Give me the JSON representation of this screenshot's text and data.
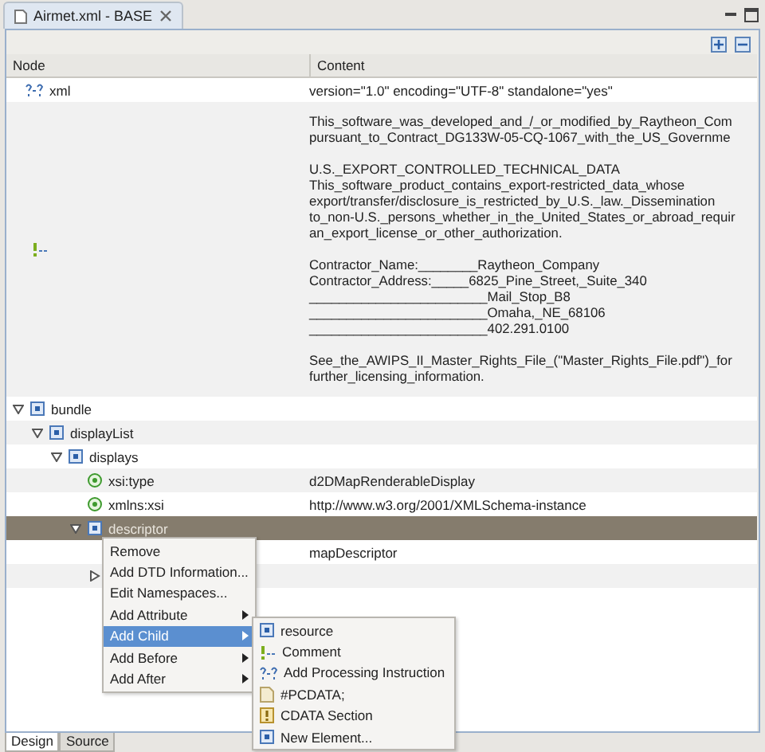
{
  "editor_tab": {
    "title": "Airmet.xml - BASE",
    "selected": true
  },
  "columns": [
    "Node",
    "Content"
  ],
  "declaration": {
    "name": "xml",
    "content": "version=\"1.0\" encoding=\"UTF-8\" standalone=\"yes\""
  },
  "comment": {
    "paragraphs": [
      [
        "This_software_was_developed_and_/_or_modified_by_Raytheon_Com",
        "pursuant_to_Contract_DG133W-05-CQ-1067_with_the_US_Governme"
      ],
      [
        "U.S._EXPORT_CONTROLLED_TECHNICAL_DATA",
        "This_software_product_contains_export-restricted_data_whose",
        "export/transfer/disclosure_is_restricted_by_U.S._law._Dissemination",
        "to_non-U.S._persons_whether_in_the_United_States_or_abroad_requir",
        "an_export_license_or_other_authorization."
      ],
      [
        "Contractor_Name:________Raytheon_Company",
        "Contractor_Address:_____6825_Pine_Street,_Suite_340",
        "________________________Mail_Stop_B8",
        "________________________Omaha,_NE_68106",
        "________________________402.291.0100"
      ],
      [
        "See_the_AWIPS_II_Master_Rights_File_(\"Master_Rights_File.pdf\")_for",
        "further_licensing_information."
      ]
    ]
  },
  "tree": [
    {
      "kind": "element",
      "name": "bundle",
      "expanded": true,
      "selected": false,
      "children": [
        {
          "kind": "element",
          "name": "displayList",
          "expanded": true,
          "selected": false,
          "children": [
            {
              "kind": "element",
              "name": "displays",
              "expanded": true,
              "selected": false,
              "children": [
                {
                  "kind": "attribute",
                  "name": "xsi:type",
                  "content": "d2DMapRenderableDisplay",
                  "selected": false
                },
                {
                  "kind": "attribute",
                  "name": "xmlns:xsi",
                  "content": "http://www.w3.org/2001/XMLSchema-instance",
                  "selected": false
                },
                {
                  "kind": "element",
                  "name": "descriptor",
                  "expanded": true,
                  "selected": true,
                  "children": [
                    {
                      "kind": "attribute",
                      "content": "mapDescriptor",
                      "selected": false
                    },
                    {
                      "kind": "element",
                      "expanded": false,
                      "selected": false
                    }
                  ]
                }
              ]
            }
          ]
        }
      ]
    }
  ],
  "context_menu": [
    {
      "label": "Remove",
      "submenu": false,
      "selected": false
    },
    {
      "label": "Add DTD Information...",
      "submenu": false,
      "selected": false
    },
    {
      "label": "Edit Namespaces...",
      "submenu": false,
      "selected": false
    },
    {
      "label": "Add Attribute",
      "submenu": true,
      "selected": false
    },
    {
      "label": "Add Child",
      "submenu": true,
      "selected": true
    },
    {
      "label": "Add Before",
      "submenu": true,
      "selected": false
    },
    {
      "label": "Add After",
      "submenu": true,
      "selected": false
    }
  ],
  "submenu": [
    {
      "kind": "element",
      "label": "resource"
    },
    {
      "kind": "comment",
      "label": "Comment"
    },
    {
      "kind": "instruction",
      "label": "Add Processing Instruction"
    },
    {
      "kind": "text",
      "label": "#PCDATA;"
    },
    {
      "kind": "cdata",
      "label": "CDATA Section"
    },
    {
      "kind": "element",
      "label": "New Element..."
    }
  ],
  "bottom_tabs": [
    {
      "label": "Design",
      "selected": true
    },
    {
      "label": "Source",
      "selected": false
    }
  ]
}
